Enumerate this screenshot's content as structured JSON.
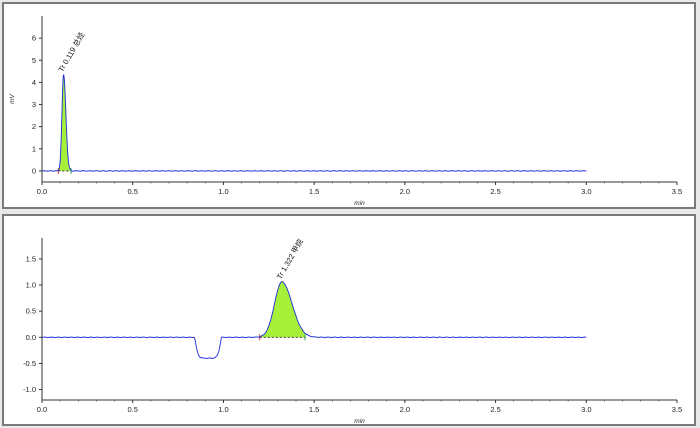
{
  "colors": {
    "trace": "#1c2bd8",
    "peak_fill": "#a6f03a",
    "axis": "#333333",
    "marker": "#d63a3a",
    "panel_border": "#7a7a7a"
  },
  "chart_data": [
    {
      "type": "line",
      "title": "",
      "xlabel": "min",
      "ylabel": "mV",
      "xlim": [
        0.0,
        3.5
      ],
      "ylim": [
        -0.5,
        7.0
      ],
      "xticks": [
        0.0,
        0.5,
        1.0,
        1.5,
        2.0,
        2.5,
        3.0,
        3.5
      ],
      "xtick_labels": [
        "0.0",
        "0.5",
        "1.0",
        "1.5",
        "2.0",
        "2.5",
        "3.0",
        "3.5"
      ],
      "yticks": [
        0,
        1,
        2,
        3,
        4,
        5,
        6
      ],
      "ytick_labels": [
        "0",
        "1",
        "2",
        "3",
        "4",
        "5",
        "6"
      ],
      "baseline": 0.0,
      "trace_end_x": 3.0,
      "dips": [],
      "peaks": [
        {
          "label": "Tr 0.119 总烃",
          "retention_time": 0.119,
          "height": 4.35,
          "width_sigma": 0.01,
          "start": 0.09,
          "end": 0.16
        }
      ]
    },
    {
      "type": "line",
      "title": "",
      "xlabel": "min",
      "ylabel": "",
      "xlim": [
        0.0,
        3.5
      ],
      "ylim": [
        -1.2,
        1.9
      ],
      "xticks": [
        0.0,
        0.5,
        1.0,
        1.5,
        2.0,
        2.5,
        3.0,
        3.5
      ],
      "xtick_labels": [
        "0.0",
        "0.5",
        "1.0",
        "1.5",
        "2.0",
        "2.5",
        "3.0",
        "3.5"
      ],
      "yticks": [
        -1.0,
        -0.5,
        0.0,
        0.5,
        1.0,
        1.5
      ],
      "ytick_labels": [
        "-1.0",
        "-0.5",
        "0.0",
        "0.5",
        "1.0",
        "1.5"
      ],
      "baseline": 0.0,
      "trace_end_x": 3.0,
      "dips": [
        {
          "start": 0.84,
          "end": 0.99,
          "depth": -0.4
        }
      ],
      "peaks": [
        {
          "label": "Tr 1.322 甲烷",
          "retention_time": 1.322,
          "height": 1.06,
          "width_sigma": 0.045,
          "start": 1.2,
          "end": 1.45
        }
      ]
    }
  ]
}
